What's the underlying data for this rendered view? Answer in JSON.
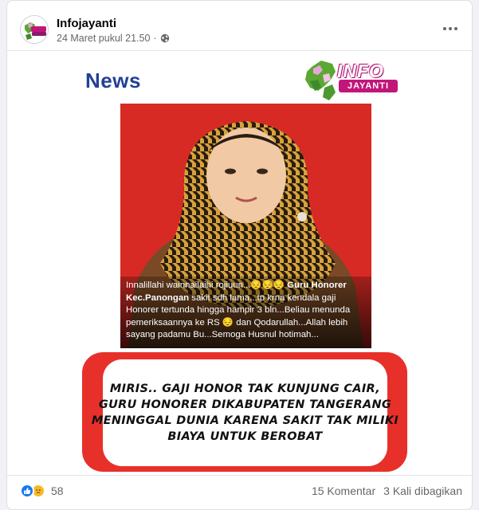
{
  "post": {
    "page_name": "Infojayanti",
    "timestamp": "24 Maret pukul 21.50",
    "separator": "·",
    "privacy_icon": "globe-icon",
    "more_icon": "more-horizontal-icon"
  },
  "image": {
    "news_label": "News",
    "logo_text": "INFO",
    "logo_subtext": "JAYANTI",
    "caption_part1": "Innalillahi wainnailaihi rojiuun...😔😔😔 ",
    "caption_bold": "Guru Honorer Kec.Panongan",
    "caption_part2": "  sakit sdh lama...tp krna kendala gaji Honorer tertunda hingga hampir 3 bln...Beliau menunda pemeriksaannya ke RS 😔  dan Qodarullah...Allah lebih sayang padamu Bu...Semoga Husnul hotimah...",
    "headline_lines": [
      "MIRIS.. GAJI HONOR TAK KUNJUNG CAIR,",
      "GURU HONORER DIKABUPATEN TANGERANG",
      "MENINGGAL DUNIA KARENA SAKIT TAK  MILIKI",
      "BIAYA UNTUK BEROBAT"
    ]
  },
  "footer": {
    "reaction_count": "58",
    "comments": "15 Komentar",
    "shares": "3 Kali dibagikan"
  },
  "colors": {
    "news_blue": "#233f96",
    "photo_red": "#d72a24",
    "frame_red": "#e8302a",
    "brand_magenta": "#c2157a"
  }
}
